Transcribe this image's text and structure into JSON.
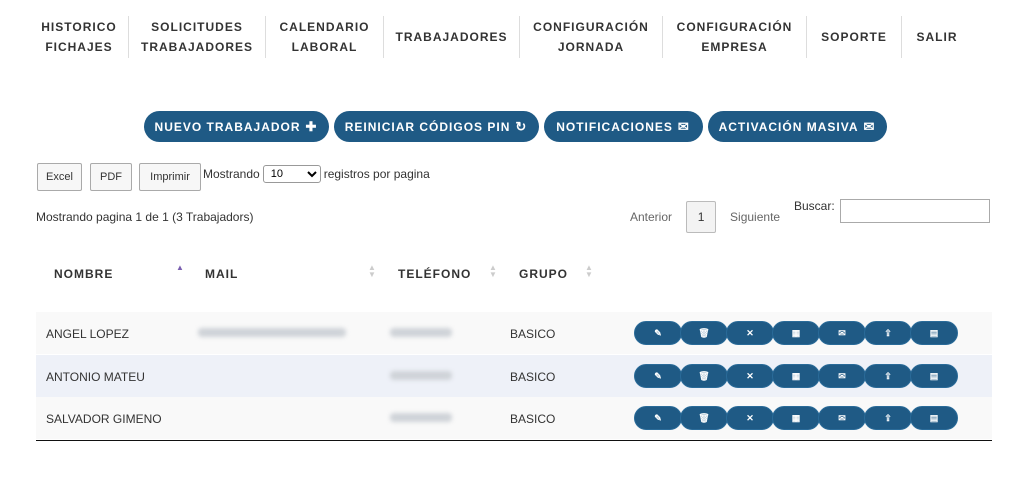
{
  "nav": [
    {
      "line1": "HISTORICO",
      "line2": "FICHAJES"
    },
    {
      "line1": "SOLICITUDES",
      "line2": "TRABAJADORES"
    },
    {
      "line1": "CALENDARIO",
      "line2": "LABORAL"
    },
    {
      "line1": "TRABAJADORES",
      "line2": ""
    },
    {
      "line1": "CONFIGURACIÓN",
      "line2": "JORNADA"
    },
    {
      "line1": "CONFIGURACIÓN",
      "line2": "EMPRESA"
    },
    {
      "line1": "SOPORTE",
      "line2": ""
    },
    {
      "line1": "SALIR",
      "line2": ""
    }
  ],
  "actions": [
    {
      "label": "NUEVO TRABAJADOR",
      "icon": "plus-icon",
      "glyph": "✚"
    },
    {
      "label": "REINICIAR CÓDIGOS PIN",
      "icon": "refresh-icon",
      "glyph": "↻"
    },
    {
      "label": "NOTIFICACIONES",
      "icon": "envelope-icon",
      "glyph": "✉"
    },
    {
      "label": "ACTIVACIÓN MASIVA",
      "icon": "envelope-icon",
      "glyph": "✉"
    }
  ],
  "export": {
    "excel": "Excel",
    "pdf": "PDF",
    "print": "Imprimir"
  },
  "length": {
    "prefix": "Mostrando",
    "selected": "10",
    "suffix": "registros por pagina"
  },
  "info": "Mostrando pagina 1 de 1 (3 Trabajadors)",
  "pagination": {
    "prev": "Anterior",
    "page": "1",
    "next": "Siguiente"
  },
  "search": {
    "label": "Buscar:",
    "value": ""
  },
  "columns": {
    "name": "NOMBRE",
    "mail": "MAIL",
    "phone": "TELÉFONO",
    "group": "GRUPO"
  },
  "rows": [
    {
      "name": "ANGEL LOPEZ",
      "group": "BASICO"
    },
    {
      "name": "ANTONIO MATEU",
      "group": "BASICO"
    },
    {
      "name": "SALVADOR GIMENO",
      "group": "BASICO"
    }
  ],
  "row_actions": [
    {
      "icon": "edit-icon",
      "glyph": "✎"
    },
    {
      "icon": "trash-icon",
      "glyph": "🗑"
    },
    {
      "icon": "close-icon",
      "glyph": "✕"
    },
    {
      "icon": "calendar-icon",
      "glyph": "▦"
    },
    {
      "icon": "envelope-icon",
      "glyph": "✉"
    },
    {
      "icon": "share-icon",
      "glyph": "⇪"
    },
    {
      "icon": "table-icon",
      "glyph": "▤"
    }
  ],
  "colors": {
    "primary": "#1f5a85",
    "row_alt": "#eef1f8",
    "sort_active": "#7a5fb0"
  }
}
